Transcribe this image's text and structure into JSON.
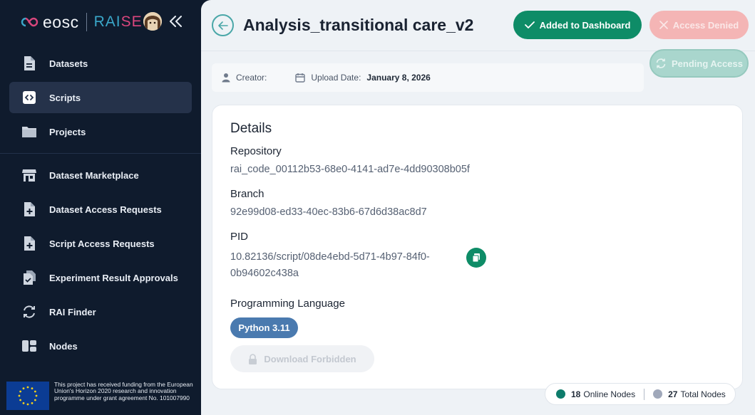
{
  "brand": {
    "logo": "eosc",
    "raise_part1": "RAI",
    "raise_part2": "SE"
  },
  "sidebar": {
    "items": [
      {
        "label": "Datasets",
        "icon": "file-icon"
      },
      {
        "label": "Scripts",
        "icon": "code-icon",
        "active": true
      },
      {
        "label": "Projects",
        "icon": "folder-icon"
      },
      {
        "label": "Dataset Marketplace",
        "icon": "store-icon"
      },
      {
        "label": "Dataset Access Requests",
        "icon": "file-plus-icon"
      },
      {
        "label": "Script Access Requests",
        "icon": "file-plus-icon"
      },
      {
        "label": "Experiment Result Approvals",
        "icon": "files-check-icon"
      },
      {
        "label": "RAI Finder",
        "icon": "refresh-icon"
      },
      {
        "label": "Nodes",
        "icon": "nodes-icon"
      }
    ],
    "funding_text": "This project has received funding from the European Union's Horizon 2020 research and innovation programme under grant agreement No. 101007990"
  },
  "header": {
    "title": "Analysis_transitional care_v2",
    "added_label": "Added to Dashboard",
    "denied_label": "Access Denied",
    "pending_label": "Pending Access"
  },
  "meta": {
    "creator_label": "Creator:",
    "creator_value": "",
    "upload_label": "Upload Date:",
    "upload_value": "January 8, 2026"
  },
  "details": {
    "title": "Details",
    "repository_label": "Repository",
    "repository_value": "rai_code_00112b53-68e0-4141-ad7e-4dd90308b05f",
    "branch_label": "Branch",
    "branch_value": "92e99d08-ed33-40ec-83b6-67d6d38ac8d7",
    "pid_label": "PID",
    "pid_value": "10.82136/script/08de4ebd-5d71-4b97-84f0-0b94602c438a",
    "language_label": "Programming Language",
    "language_value": "Python 3.11",
    "download_label": "Download Forbidden"
  },
  "nodes": {
    "online_count": "18",
    "online_label": "Online Nodes",
    "total_count": "27",
    "total_label": "Total Nodes"
  },
  "colors": {
    "primary": "#0e8c67",
    "danger_light": "#f4b5b5",
    "sidebar_bg": "#0f1b2d",
    "badge": "#4a7aaf",
    "online_dot": "#0e7c6b",
    "total_dot": "#a0a8ba"
  }
}
